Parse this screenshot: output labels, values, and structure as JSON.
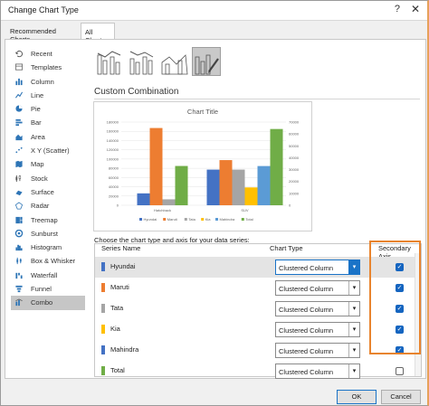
{
  "window": {
    "title": "Change Chart Type",
    "help": "?",
    "close": "✕"
  },
  "tabs": [
    {
      "label": "Recommended Charts"
    },
    {
      "label": "All Charts"
    }
  ],
  "sidebar": {
    "items": [
      {
        "label": "Recent",
        "icon": "recent-icon"
      },
      {
        "label": "Templates",
        "icon": "templates-icon"
      },
      {
        "label": "Column",
        "icon": "column-icon"
      },
      {
        "label": "Line",
        "icon": "line-icon"
      },
      {
        "label": "Pie",
        "icon": "pie-icon"
      },
      {
        "label": "Bar",
        "icon": "bar-icon"
      },
      {
        "label": "Area",
        "icon": "area-icon"
      },
      {
        "label": "X Y (Scatter)",
        "icon": "scatter-icon"
      },
      {
        "label": "Map",
        "icon": "map-icon"
      },
      {
        "label": "Stock",
        "icon": "stock-icon"
      },
      {
        "label": "Surface",
        "icon": "surface-icon"
      },
      {
        "label": "Radar",
        "icon": "radar-icon"
      },
      {
        "label": "Treemap",
        "icon": "treemap-icon"
      },
      {
        "label": "Sunburst",
        "icon": "sunburst-icon"
      },
      {
        "label": "Histogram",
        "icon": "histogram-icon"
      },
      {
        "label": "Box & Whisker",
        "icon": "box-whisker-icon"
      },
      {
        "label": "Waterfall",
        "icon": "waterfall-icon"
      },
      {
        "label": "Funnel",
        "icon": "funnel-icon"
      },
      {
        "label": "Combo",
        "icon": "combo-icon"
      }
    ],
    "selected": "Combo"
  },
  "combo": {
    "title": "Custom Combination",
    "series_prompt": "Choose the chart type and axis for your data series:",
    "headers": {
      "name": "Series Name",
      "type": "Chart Type",
      "axis": "Secondary Axis"
    },
    "series": [
      {
        "name": "Hyundai",
        "color": "#4472c4",
        "type": "Clustered Column",
        "secondary": true
      },
      {
        "name": "Maruti",
        "color": "#ed7d31",
        "type": "Clustered Column",
        "secondary": true
      },
      {
        "name": "Tata",
        "color": "#a5a5a5",
        "type": "Clustered Column",
        "secondary": true
      },
      {
        "name": "Kia",
        "color": "#ffc000",
        "type": "Clustered Column",
        "secondary": true
      },
      {
        "name": "Mahindra",
        "color": "#4472c4",
        "type": "Clustered Column",
        "secondary": true
      },
      {
        "name": "Total",
        "color": "#70ad47",
        "type": "Clustered Column",
        "secondary": false
      }
    ]
  },
  "chart_data": {
    "type": "bar",
    "title": "Chart Title",
    "categories": [
      "Hatchback",
      "SUV"
    ],
    "primary_ticks": [
      "180000",
      "160000",
      "140000",
      "120000",
      "100000",
      "80000",
      "60000",
      "40000",
      "20000",
      "0"
    ],
    "secondary_ticks": [
      "70000",
      "60000",
      "50000",
      "40000",
      "30000",
      "20000",
      "10000",
      "0"
    ],
    "ylim_primary": [
      0,
      180000
    ],
    "ylim_secondary": [
      0,
      70000
    ],
    "series": [
      {
        "name": "Hyundai",
        "color": "#4472c4",
        "axis": "secondary",
        "values": [
          10000,
          30000
        ]
      },
      {
        "name": "Maruti",
        "color": "#ed7d31",
        "axis": "secondary",
        "values": [
          65000,
          38000
        ]
      },
      {
        "name": "Tata",
        "color": "#a5a5a5",
        "axis": "secondary",
        "values": [
          5000,
          30000
        ]
      },
      {
        "name": "Kia",
        "color": "#ffc000",
        "axis": "secondary",
        "values": [
          0,
          15000
        ]
      },
      {
        "name": "Mahindra",
        "color": "#5b9bd5",
        "axis": "secondary",
        "values": [
          0,
          33000
        ]
      },
      {
        "name": "Total",
        "color": "#70ad47",
        "axis": "primary",
        "values": [
          85000,
          165000
        ]
      }
    ]
  },
  "buttons": {
    "ok": "OK",
    "cancel": "Cancel"
  }
}
